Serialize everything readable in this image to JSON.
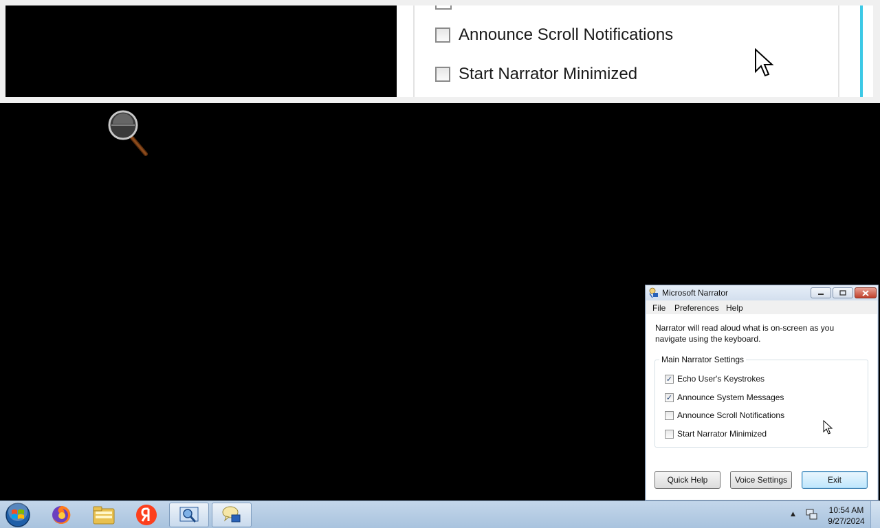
{
  "magnifier": {
    "rows": [
      {
        "label": "Announce Scroll Notifications"
      },
      {
        "label": "Start Narrator Minimized"
      }
    ]
  },
  "narrator": {
    "title": "Microsoft Narrator",
    "menu": [
      "File",
      "Preferences",
      "Help"
    ],
    "intro": "Narrator will read aloud what is on-screen as you navigate using the keyboard.",
    "group_title": "Main Narrator Settings",
    "options": [
      {
        "label": "Echo User's Keystrokes",
        "checked": true
      },
      {
        "label": "Announce System Messages",
        "checked": true
      },
      {
        "label": "Announce Scroll Notifications",
        "checked": false
      },
      {
        "label": "Start Narrator Minimized",
        "checked": false
      }
    ],
    "buttons": {
      "quick_help": "Quick Help",
      "voice_settings": "Voice Settings",
      "exit": "Exit"
    },
    "check_glyph": "✓"
  },
  "taskbar": {
    "items": [
      "start-orb",
      "firefox",
      "file-explorer",
      "yandex-browser",
      "magnifier",
      "narrator"
    ],
    "clock": {
      "time": "10:54 AM",
      "date": "9/27/2024"
    }
  }
}
